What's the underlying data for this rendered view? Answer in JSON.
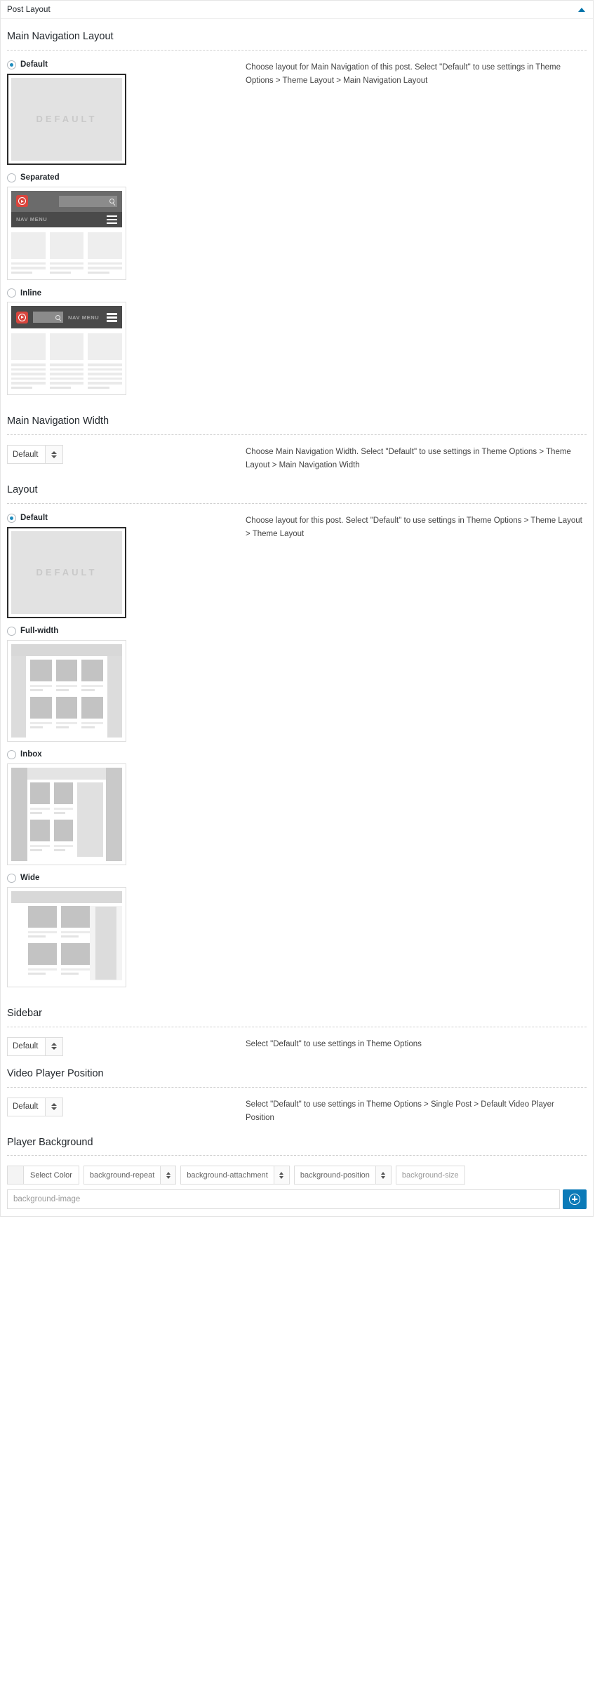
{
  "postbox": {
    "title": "Post Layout",
    "toggle_icon": "caret-up-icon",
    "toggle_color": "#0073aa"
  },
  "sections": {
    "main_nav_layout": {
      "title": "Main Navigation Layout",
      "description": "Choose layout for Main Navigation of this post. Select \"Default\" to use settings in Theme Options > Theme Layout > Main Navigation Layout",
      "options": [
        {
          "label": "Default",
          "selected": true,
          "preview": "default-placeholder",
          "placeholder_text": "DEFAULT"
        },
        {
          "label": "Separated",
          "selected": false,
          "preview": "nav-separated"
        },
        {
          "label": "Inline",
          "selected": false,
          "preview": "nav-inline"
        }
      ],
      "preview_labels": {
        "nav_menu": "NAV MENU",
        "logo_icon": "play-logo-icon",
        "search_icon": "search-icon",
        "menu_icon": "hamburger-icon"
      }
    },
    "main_nav_width": {
      "title": "Main Navigation Width",
      "description": "Choose Main Navigation Width. Select \"Default\" to use settings in Theme Options > Theme Layout > Main Navigation Width",
      "select_value": "Default"
    },
    "layout": {
      "title": "Layout",
      "description": "Choose layout for this post. Select \"Default\" to use settings in Theme Options > Theme Layout > Theme Layout",
      "options": [
        {
          "label": "Default",
          "selected": true,
          "preview": "default-placeholder",
          "placeholder_text": "DEFAULT"
        },
        {
          "label": "Full-width",
          "selected": false,
          "preview": "layout-fullwidth"
        },
        {
          "label": "Inbox",
          "selected": false,
          "preview": "layout-inbox"
        },
        {
          "label": "Wide",
          "selected": false,
          "preview": "layout-wide"
        }
      ]
    },
    "sidebar": {
      "title": "Sidebar",
      "description": "Select \"Default\" to use settings in Theme Options",
      "select_value": "Default"
    },
    "video_player_position": {
      "title": "Video Player Position",
      "description": "Select \"Default\" to use settings in Theme Options > Single Post > Default Video Player Position",
      "select_value": "Default"
    },
    "player_background": {
      "title": "Player Background",
      "color_label": "Select Color",
      "repeat_label": "background-repeat",
      "attachment_label": "background-attachment",
      "position_label": "background-position",
      "size_label": "background-size",
      "image_placeholder": "background-image",
      "upload_icon": "plus-circle-icon",
      "upload_button_color": "#0b7ab8"
    }
  }
}
